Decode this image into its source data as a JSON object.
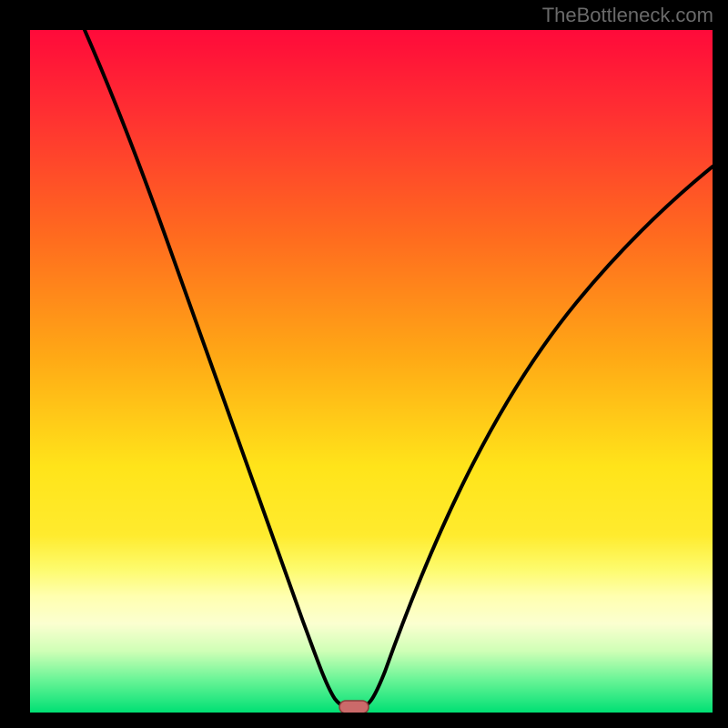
{
  "watermark": "TheBottleneck.com",
  "colors": {
    "frame": "#000000",
    "curve": "#000000",
    "marker_fill": "#cb6a6a",
    "marker_stroke": "#8c3b3a",
    "gradient_stops": [
      {
        "pos": 0.0,
        "color": "#ff0a3a"
      },
      {
        "pos": 0.12,
        "color": "#ff2f32"
      },
      {
        "pos": 0.3,
        "color": "#ff6a1f"
      },
      {
        "pos": 0.48,
        "color": "#ffa915"
      },
      {
        "pos": 0.64,
        "color": "#ffe41a"
      },
      {
        "pos": 0.74,
        "color": "#ffeb2e"
      },
      {
        "pos": 0.79,
        "color": "#fdfb6d"
      },
      {
        "pos": 0.83,
        "color": "#ffffb0"
      },
      {
        "pos": 0.87,
        "color": "#fbffd0"
      },
      {
        "pos": 0.91,
        "color": "#cfffb6"
      },
      {
        "pos": 0.95,
        "color": "#6ef598"
      },
      {
        "pos": 1.0,
        "color": "#00e074"
      }
    ]
  },
  "chart_data": {
    "type": "line",
    "title": "",
    "xlabel": "",
    "ylabel": "",
    "xlim": [
      0,
      1
    ],
    "ylim": [
      0,
      1
    ],
    "series": [
      {
        "name": "bottleneck-curve",
        "x": [
          0.08,
          0.12,
          0.16,
          0.2,
          0.24,
          0.28,
          0.32,
          0.36,
          0.4,
          0.44,
          0.455,
          0.47,
          0.485,
          0.52,
          0.56,
          0.6,
          0.64,
          0.68,
          0.72,
          0.76,
          0.8,
          0.84,
          0.88,
          0.92,
          0.96,
          1.0
        ],
        "y": [
          1.0,
          0.93,
          0.847,
          0.753,
          0.65,
          0.547,
          0.433,
          0.313,
          0.18,
          0.043,
          0.015,
          0.01,
          0.015,
          0.08,
          0.167,
          0.247,
          0.32,
          0.387,
          0.447,
          0.507,
          0.553,
          0.6,
          0.64,
          0.673,
          0.707,
          0.733
        ]
      }
    ],
    "marker": {
      "x": 0.47,
      "y": 0.01,
      "shape": "rounded-rect"
    },
    "baseline_y": 0.01
  }
}
